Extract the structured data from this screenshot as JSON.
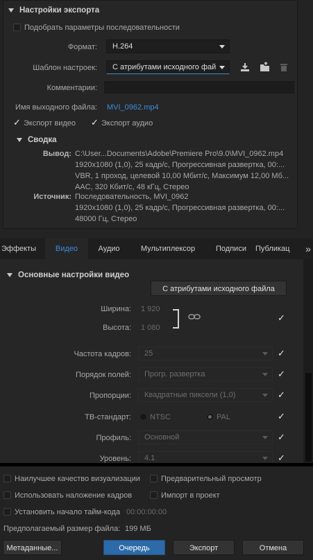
{
  "export_settings": {
    "title": "Настройки экспорта",
    "match_sequence_label": "Подобрать параметры последовательности",
    "format_label": "Формат:",
    "format_value": "H.264",
    "preset_label": "Шаблон настроек:",
    "preset_value": "С атрибутами исходного фай",
    "comments_label": "Комментарии:",
    "output_name_label": "Имя выходного файла:",
    "output_name_value": "MVI_0962.mp4",
    "export_video_label": "Экспорт видео",
    "export_audio_label": "Экспорт аудио"
  },
  "summary": {
    "title": "Сводка",
    "output_label": "Вывод:",
    "output_lines": [
      "C:\\User...Documents\\Adobe\\Premiere Pro\\9.0\\MVI_0962.mp4",
      "1920x1080 (1,0), 25 кадр/с, Прогрессивная развертка, 00:...",
      "VBR, 1 проход, целевой 10,00 Мбит/с, Максимум 12,00 Мб...",
      "AAC, 320 Кбит/с, 48 кГц, Стерео"
    ],
    "source_label": "Источник:",
    "source_lines": [
      "Последовательность, MVI_0962",
      "1920x1080 (1,0), 25 кадр/с, Прогрессивная развертка, 00:...",
      "48000 Гц, Стерео"
    ]
  },
  "tabs": [
    {
      "label": "Эффекты"
    },
    {
      "label": "Видео"
    },
    {
      "label": "Аудио"
    },
    {
      "label": "Мультиплексор"
    },
    {
      "label": "Подписи"
    },
    {
      "label": "Публикац"
    }
  ],
  "tabs_overflow": "»",
  "video": {
    "section_title": "Основные настройки видео",
    "match_source_button": "С атрибутами исходного файла",
    "width_label": "Ширина:",
    "width_value": "1 920",
    "height_label": "Высота:",
    "height_value": "1 080",
    "frame_rate_label": "Частота кадров:",
    "frame_rate_value": "25",
    "field_order_label": "Порядок полей:",
    "field_order_value": "Прогр. развертка",
    "aspect_label": "Пропорции:",
    "aspect_value": "Квадратные пиксели (1,0)",
    "tv_standard_label": "ТВ-стандарт:",
    "ntsc_label": "NTSC",
    "pal_label": "PAL",
    "profile_label": "Профиль:",
    "profile_value": "Основной",
    "level_label": "Уровень:",
    "level_value": "4.1"
  },
  "bottom": {
    "max_render_label": "Наилучшее качество визуализации",
    "preview_label": "Предварительный просмотр",
    "frame_blending_label": "Использовать наложение кадров",
    "import_project_label": "Импорт в проект",
    "set_timecode_label": "Установить начало тайм-кода",
    "timecode_value": "00:00:00:00",
    "file_size_label": "Предполагаемый размер файла:",
    "file_size_value": "199 МБ",
    "metadata_button": "Метаданные...",
    "queue_button": "Очередь",
    "export_button": "Экспорт",
    "cancel_button": "Отмена"
  },
  "colors": {
    "accent": "#3b8cdd",
    "queue_button": "#2d6aa8",
    "background": "#232323"
  }
}
